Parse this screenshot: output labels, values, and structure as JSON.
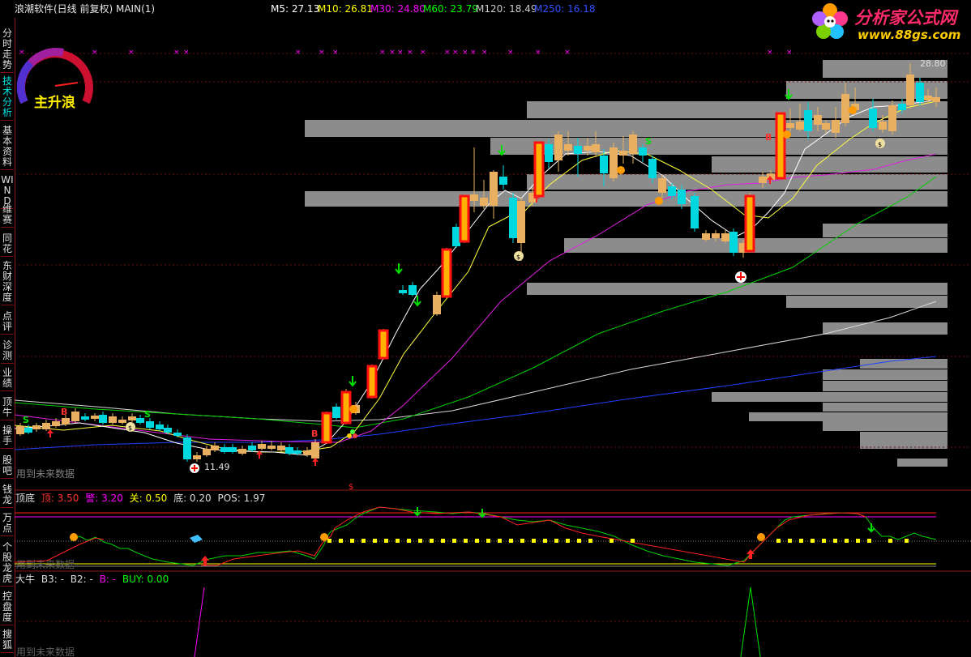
{
  "title_bar": {
    "app_title": "浪潮软件(日线 前复权) MAIN(1)",
    "ma": [
      {
        "label": "M5: 27.13",
        "color": "#ffffff"
      },
      {
        "label": "M10: 26.81",
        "color": "#ffff00"
      },
      {
        "label": "M30: 24.80",
        "color": "#ff00ff"
      },
      {
        "label": "M60: 23.79",
        "color": "#00ff00"
      },
      {
        "label": "M120: 18.49",
        "color": "#cccccc"
      },
      {
        "label": "M250: 16.18",
        "color": "#3050ff"
      }
    ]
  },
  "brand": {
    "name": "分析家公式网",
    "url": "www.88gs.com"
  },
  "gauge": {
    "label": "主升浪"
  },
  "sidebar": {
    "items": [
      {
        "label": "分时走势"
      },
      {
        "label": "技术分析"
      },
      {
        "label": "基本资料"
      },
      {
        "label": "WIND"
      },
      {
        "label": "维赛"
      },
      {
        "label": "同花"
      },
      {
        "label": "东财深度"
      },
      {
        "label": "点评"
      },
      {
        "label": "诊测"
      },
      {
        "label": "业绩"
      },
      {
        "label": "顶牛"
      },
      {
        "label": "操手"
      },
      {
        "label": "股吧"
      },
      {
        "label": "钱龙"
      },
      {
        "label": "万点"
      },
      {
        "label": "个股龙虎"
      },
      {
        "label": "控盘度"
      },
      {
        "label": "搜狐"
      }
    ]
  },
  "main_panel": {
    "price_high": "28.80",
    "price_low": "11.49",
    "future_note": "用到未来数据",
    "signal_letters": {
      "buy": "B",
      "sell": "S",
      "dollar": "$"
    }
  },
  "sub_panel_1": {
    "name": "顶底",
    "values": [
      {
        "label": "顶: 3.50",
        "color": "#ff3030"
      },
      {
        "label": "警: 3.20",
        "color": "#ff00ff"
      },
      {
        "label": "关: 0.50",
        "color": "#ffff00"
      },
      {
        "label": "底: 0.20",
        "color": "#dddddd"
      },
      {
        "label": "POS: 1.97",
        "color": "#dddddd"
      }
    ],
    "future_note": "用到未来数据"
  },
  "sub_panel_2": {
    "name": "大牛",
    "values": [
      {
        "label": "B3: -",
        "color": "#dddddd"
      },
      {
        "label": "B2: -",
        "color": "#dddddd"
      },
      {
        "label": "B: -",
        "color": "#ff00ff"
      },
      {
        "label": "BUY: 0.00",
        "color": "#00ff00"
      }
    ],
    "future_note": "用到未来数据"
  }
}
